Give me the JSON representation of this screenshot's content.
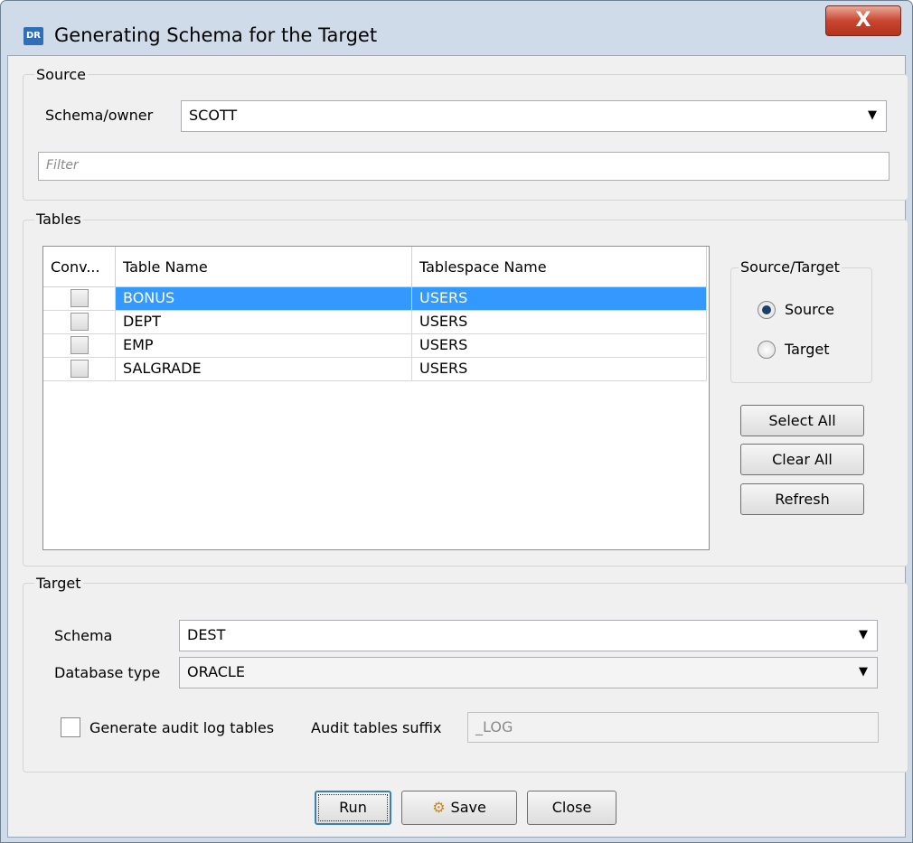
{
  "window": {
    "title": "Generating Schema for the Target",
    "app_icon_text": "DR",
    "close_glyph": "X"
  },
  "source": {
    "group_label": "Source",
    "schema_label": "Schema/owner",
    "schema_value": "SCOTT",
    "filter_placeholder": "Filter"
  },
  "tables": {
    "group_label": "Tables",
    "columns": [
      "Conv...",
      "Table Name",
      "Tablespace Name"
    ],
    "rows": [
      {
        "checked": false,
        "table_name": "BONUS",
        "tablespace": "USERS",
        "selected": true
      },
      {
        "checked": false,
        "table_name": "DEPT",
        "tablespace": "USERS",
        "selected": false
      },
      {
        "checked": false,
        "table_name": "EMP",
        "tablespace": "USERS",
        "selected": false
      },
      {
        "checked": false,
        "table_name": "SALGRADE",
        "tablespace": "USERS",
        "selected": false
      }
    ],
    "source_target": {
      "group_label": "Source/Target",
      "options": [
        "Source",
        "Target"
      ],
      "selected": "Source"
    },
    "select_all_label": "Select All",
    "clear_all_label": "Clear All",
    "refresh_label": "Refresh"
  },
  "target": {
    "group_label": "Target",
    "schema_label": "Schema",
    "schema_value": "DEST",
    "db_type_label": "Database type",
    "db_type_value": "ORACLE",
    "audit_label": "Generate audit log tables",
    "audit_checked": false,
    "suffix_label": "Audit tables suffix",
    "suffix_value": "_LOG"
  },
  "footer": {
    "run_label": "Run",
    "save_label": "Save",
    "close_label": "Close"
  }
}
